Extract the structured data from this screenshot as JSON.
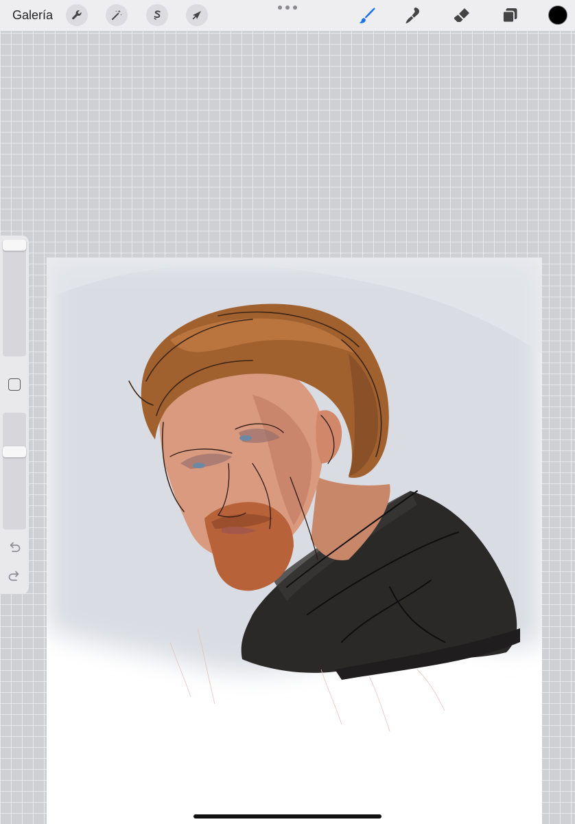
{
  "toolbar": {
    "gallery_label": "Galería",
    "left_tools": [
      {
        "icon": "wrench-icon",
        "name": "actions"
      },
      {
        "icon": "magic-wand-icon",
        "name": "adjustments"
      },
      {
        "icon": "selection-s-icon",
        "name": "selection"
      },
      {
        "icon": "arrow-cursor-icon",
        "name": "transform"
      }
    ],
    "right_tools": [
      {
        "icon": "brush-icon",
        "name": "paint",
        "active": true
      },
      {
        "icon": "smudge-icon",
        "name": "smudge",
        "active": false
      },
      {
        "icon": "eraser-icon",
        "name": "erase",
        "active": false
      },
      {
        "icon": "layers-icon",
        "name": "layers",
        "active": false
      }
    ],
    "current_color": "#000000",
    "accent_color": "#1a73e8"
  },
  "sidebar": {
    "brush_size_level": 0.0,
    "opacity_level": 0.35,
    "undo_icon": "undo-arrow-icon",
    "redo_icon": "redo-arrow-icon",
    "modify_icon": "square-modify-icon"
  },
  "canvas": {
    "artwork": "portrait-illustration"
  }
}
